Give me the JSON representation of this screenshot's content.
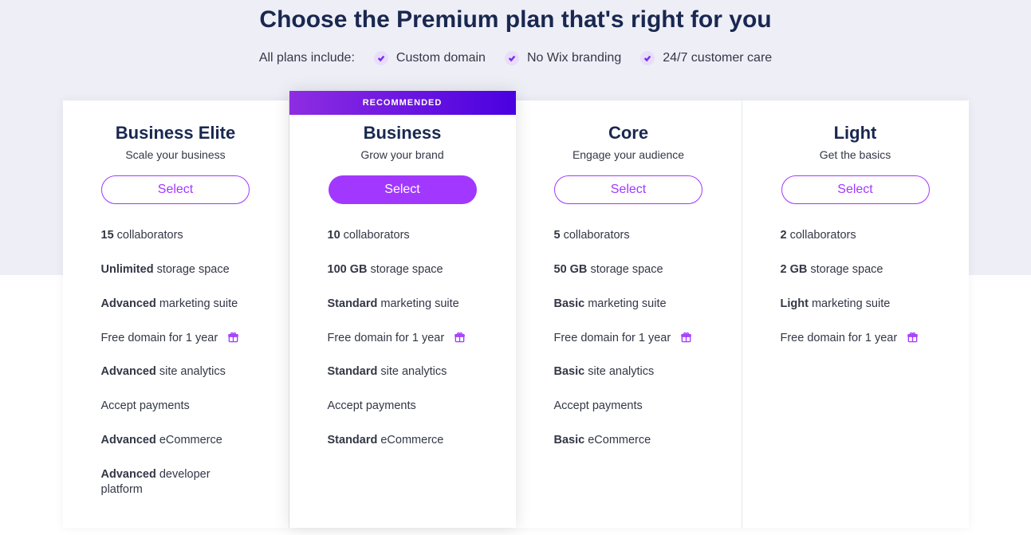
{
  "header": {
    "title": "Choose the Premium plan that's right for you",
    "includes_label": "All plans include:",
    "includes": [
      "Custom domain",
      "No Wix branding",
      "24/7 customer care"
    ]
  },
  "recommended_label": "RECOMMENDED",
  "select_label": "Select",
  "plans": [
    {
      "name": "Business Elite",
      "tagline": "Scale your business",
      "featured": false,
      "features": [
        {
          "bold": "15",
          "rest": " collaborators"
        },
        {
          "bold": "Unlimited",
          "rest": " storage space"
        },
        {
          "bold": "Advanced",
          "rest": " marketing suite"
        },
        {
          "bold": "",
          "rest": "Free domain for 1 year",
          "gift": true
        },
        {
          "bold": "Advanced",
          "rest": " site analytics"
        },
        {
          "bold": "",
          "rest": "Accept payments"
        },
        {
          "bold": "Advanced",
          "rest": " eCommerce"
        },
        {
          "bold": "Advanced",
          "rest": " developer platform"
        }
      ]
    },
    {
      "name": "Business",
      "tagline": "Grow your brand",
      "featured": true,
      "features": [
        {
          "bold": "10",
          "rest": " collaborators"
        },
        {
          "bold": "100 GB",
          "rest": " storage space"
        },
        {
          "bold": "Standard",
          "rest": " marketing suite"
        },
        {
          "bold": "",
          "rest": "Free domain for 1 year",
          "gift": true
        },
        {
          "bold": "Standard",
          "rest": " site analytics"
        },
        {
          "bold": "",
          "rest": "Accept payments"
        },
        {
          "bold": "Standard",
          "rest": " eCommerce"
        }
      ]
    },
    {
      "name": "Core",
      "tagline": "Engage your audience",
      "featured": false,
      "features": [
        {
          "bold": "5",
          "rest": " collaborators"
        },
        {
          "bold": "50 GB",
          "rest": " storage space"
        },
        {
          "bold": "Basic",
          "rest": " marketing suite"
        },
        {
          "bold": "",
          "rest": "Free domain for 1 year",
          "gift": true
        },
        {
          "bold": "Basic",
          "rest": " site analytics"
        },
        {
          "bold": "",
          "rest": "Accept payments"
        },
        {
          "bold": "Basic",
          "rest": " eCommerce"
        }
      ]
    },
    {
      "name": "Light",
      "tagline": "Get the basics",
      "featured": false,
      "features": [
        {
          "bold": "2",
          "rest": " collaborators"
        },
        {
          "bold": "2 GB",
          "rest": " storage space"
        },
        {
          "bold": "Light",
          "rest": " marketing suite"
        },
        {
          "bold": "",
          "rest": "Free domain for 1 year",
          "gift": true
        }
      ]
    }
  ]
}
